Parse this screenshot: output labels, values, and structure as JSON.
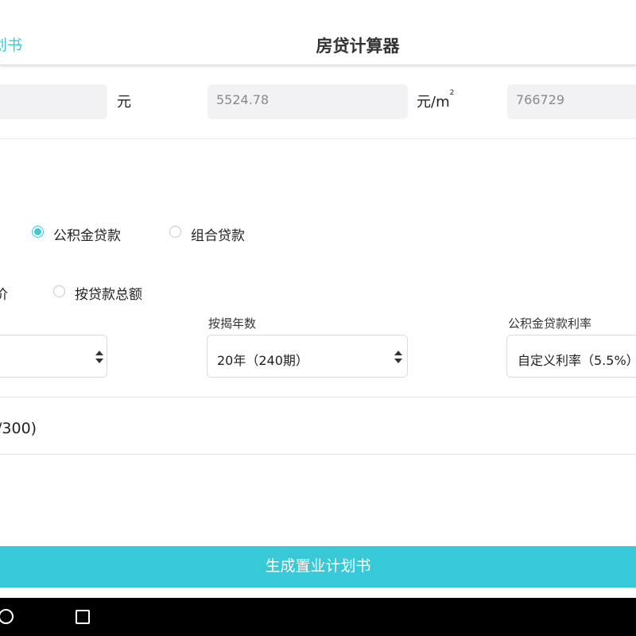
{
  "header": {
    "back_label": "划书",
    "title": "房贷计算器"
  },
  "price_row": {
    "unit_total": "元",
    "unit_price_value": "5524.78",
    "unit_area": "元/m",
    "unit_area_sup": "2",
    "total_value": "766729"
  },
  "loan_type": {
    "options": [
      {
        "label": "公积金贷款",
        "selected": true
      },
      {
        "label": "组合贷款",
        "selected": false
      }
    ]
  },
  "calc_method": {
    "partial_label": "价",
    "option_total": "按贷款总额",
    "option_total_selected": false
  },
  "selects": {
    "years_label": "按揭年数",
    "years_value": "20年（240期）",
    "rate_label": "公积金贷款利率",
    "rate_value": "自定义利率（5.5%）"
  },
  "notes": {
    "counter": "/300)"
  },
  "actions": {
    "generate_label": "生成置业计划书"
  },
  "colors": {
    "accent": "#38c9d8",
    "field_bg": "#f2f2f5",
    "nav_bg": "#000000"
  },
  "icons": [
    "radio-checked-icon",
    "radio-unchecked-icon",
    "select-arrows-icon",
    "home-circle-icon",
    "recent-apps-square-icon"
  ]
}
